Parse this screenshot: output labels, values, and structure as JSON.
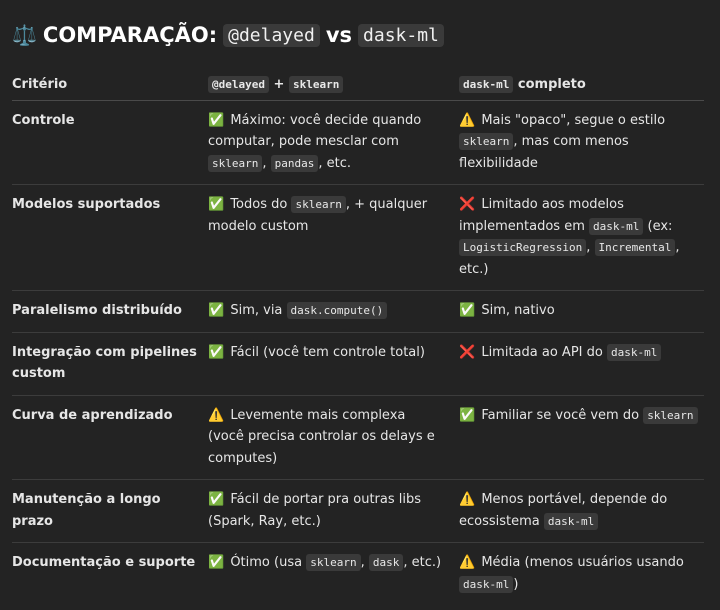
{
  "title": {
    "emoji": "⚖️",
    "prefix": "COMPARAÇÃO:",
    "code_a": "@delayed",
    "vs": "vs",
    "code_b": "dask-ml"
  },
  "header": {
    "col1": "Critério",
    "col2_code1": "@delayed",
    "col2_plus": "+",
    "col2_code2": "sklearn",
    "col3_code": "dask-ml",
    "col3_text": "completo"
  },
  "rows": [
    {
      "criterion": "Controle",
      "a": {
        "icon": "✅",
        "t1": "Máximo: você decide quando computar, pode mesclar com",
        "code1": "sklearn",
        "sep": ",",
        "code2": "pandas",
        "t2": ", etc."
      },
      "b": {
        "icon": "⚠️",
        "t1": "Mais \"opaco\", segue o estilo",
        "code1": "sklearn",
        "t2": ", mas com menos flexibilidade"
      }
    },
    {
      "criterion": "Modelos suportados",
      "a": {
        "icon": "✅",
        "t1": "Todos do",
        "code1": "sklearn",
        "t2": ", + qualquer modelo custom"
      },
      "b": {
        "icon": "❌",
        "t1": "Limitado aos modelos implementados em",
        "code1": "dask-ml",
        "t2": "(ex:",
        "code2": "LogisticRegression",
        "sep": ",",
        "code3": "Incremental",
        "t3": ", etc.)"
      }
    },
    {
      "criterion": "Paralelismo distribuído",
      "a": {
        "icon": "✅",
        "t1": "Sim, via",
        "code1": "dask.compute()"
      },
      "b": {
        "icon": "✅",
        "t1": "Sim, nativo"
      }
    },
    {
      "criterion": "Integração com pipelines custom",
      "a": {
        "icon": "✅",
        "t1": "Fácil (você tem controle total)"
      },
      "b": {
        "icon": "❌",
        "t1": "Limitada ao API do",
        "code1": "dask-ml"
      }
    },
    {
      "criterion": "Curva de aprendizado",
      "a": {
        "icon": "⚠️",
        "t1": "Levemente mais complexa (você precisa controlar os delays e computes)"
      },
      "b": {
        "icon": "✅",
        "t1": "Familiar se você vem do",
        "code1": "sklearn"
      }
    },
    {
      "criterion": "Manutenção a longo prazo",
      "a": {
        "icon": "✅",
        "t1": "Fácil de portar pra outras libs (Spark, Ray, etc.)"
      },
      "b": {
        "icon": "⚠️",
        "t1": "Menos portável, depende do ecossistema",
        "code1": "dask-ml"
      }
    },
    {
      "criterion": "Documentação e suporte",
      "a": {
        "icon": "✅",
        "t1": "Ótimo (usa",
        "code1": "sklearn",
        "sep": ",",
        "code2": "dask",
        "t2": ", etc.)"
      },
      "b": {
        "icon": "⚠️",
        "t1": "Média (menos usuários usando",
        "code1": "dask-ml",
        "t2": ")"
      }
    }
  ],
  "colors": {
    "background": "#232323",
    "text": "#e6e6e6",
    "code_bg": "#3a3a3a",
    "check": "#3fbf4f",
    "warning": "#f2c230",
    "cross": "#e84343"
  }
}
